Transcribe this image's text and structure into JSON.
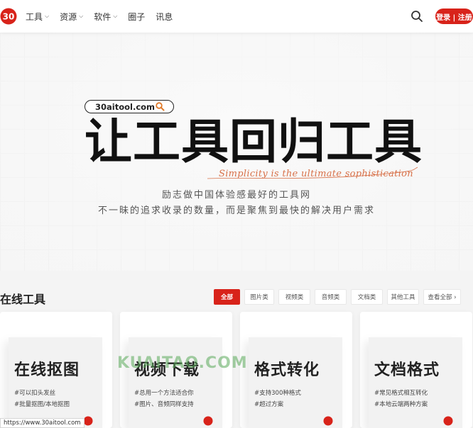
{
  "header": {
    "logo": "30",
    "nav": [
      {
        "label": "工具",
        "has_dropdown": true
      },
      {
        "label": "资源",
        "has_dropdown": true
      },
      {
        "label": "软件",
        "has_dropdown": true
      },
      {
        "label": "圈子",
        "has_dropdown": false
      },
      {
        "label": "讯息",
        "has_dropdown": false
      }
    ],
    "search_icon": "search-icon",
    "login_label": "登录 | 注册"
  },
  "hero": {
    "domain_pill": "30aitool.com",
    "title": "让工具回归工具",
    "script_line": "Simplicity is the ultimate sophistication",
    "subtitle_1": "励志做中国体验感最好的工具网",
    "subtitle_2": "不一昧的追求收录的数量，而是聚焦到最快的解决用户需求"
  },
  "section": {
    "title": "在线工具",
    "tabs": [
      "全部",
      "图片类",
      "视频类",
      "音频类",
      "文档类",
      "其他工具"
    ],
    "view_all": "查看全部 ›"
  },
  "cards": [
    {
      "title": "在线抠图",
      "tags": [
        "#可以扣头发丝",
        "#批量抠图/本地抠图"
      ]
    },
    {
      "title": "视频下载",
      "tags": [
        "#总用一个方法适合你",
        "#图片、音频同样支持"
      ]
    },
    {
      "title": "格式转化",
      "tags": [
        "#支持300种格式",
        "#超过方案"
      ]
    },
    {
      "title": "文档格式",
      "tags": [
        "#常见格式相互转化",
        "#本地云端两种方案"
      ]
    }
  ],
  "watermark": "KUAITAO.COM",
  "status_url": "https://www.30aitool.com",
  "colors": {
    "accent": "#d8231a",
    "script": "#d8724a"
  }
}
